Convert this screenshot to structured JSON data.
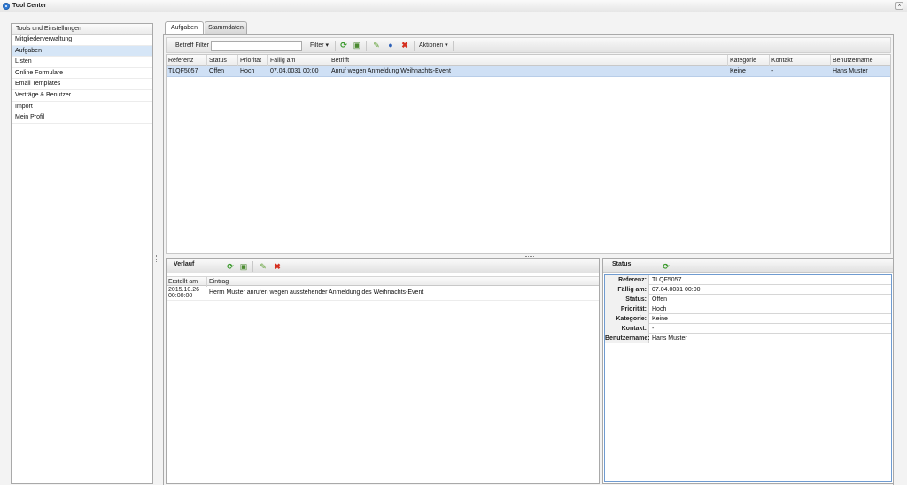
{
  "window": {
    "title": "Tool Center"
  },
  "sidebar": {
    "header": "Tools und Einstellungen",
    "items": [
      {
        "label": "Mitgliederverwaltung"
      },
      {
        "label": "Aufgaben"
      },
      {
        "label": "Listen"
      },
      {
        "label": "Online Formulare"
      },
      {
        "label": "Email Templates"
      },
      {
        "label": "Verträge & Benutzer"
      },
      {
        "label": "Import"
      },
      {
        "label": "Mein Profil"
      }
    ]
  },
  "tabs": [
    {
      "label": "Aufgaben"
    },
    {
      "label": "Stammdaten"
    }
  ],
  "toolbar": {
    "filter_label": "Betreff Filter :",
    "filter_value": "",
    "filter_button": "Filter ▾",
    "actions_button": "Aktionen ▾",
    "icons": [
      "refresh-icon",
      "new-icon",
      "edit-icon",
      "user-icon",
      "delete-icon"
    ]
  },
  "tasks": {
    "columns": [
      "Referenz",
      "Status",
      "Priorität",
      "Fällig am",
      "Betrifft",
      "Kategorie",
      "Kontakt",
      "Benutzername"
    ],
    "rows": [
      {
        "referenz": "TLQF5057",
        "status": "Offen",
        "prioritaet": "Hoch",
        "faellig": "07.04.0031 00:00",
        "betrifft": "Anruf wegen Anmeldung Weihnachts-Event",
        "kategorie": "Keine",
        "kontakt": "-",
        "benutzer": "Hans Muster"
      }
    ]
  },
  "verlauf": {
    "title": "Verlauf",
    "columns": [
      "Erstellt am",
      "Eintrag"
    ],
    "rows": [
      {
        "date_line1": "2015.10.26",
        "date_line2": "00:00:00",
        "entry": "Herrn Muster anrufen wegen ausstehender Anmeldung des Weihnachts-Event"
      }
    ]
  },
  "status_panel": {
    "title": "Status",
    "fields": [
      {
        "key": "Referenz:",
        "value": "TLQF5057"
      },
      {
        "key": "Fällig am:",
        "value": "07.04.0031 00:00"
      },
      {
        "key": "Status:",
        "value": "Offen"
      },
      {
        "key": "Priorität:",
        "value": "Hoch"
      },
      {
        "key": "Kategorie:",
        "value": "Keine"
      },
      {
        "key": "Kontakt:",
        "value": "-"
      },
      {
        "key": "Benutzername:",
        "value": "Hans Muster"
      }
    ]
  },
  "colors": {
    "selection": "#cfe0f5",
    "sidebar_selected": "#d6e6f7",
    "status_border": "#6f9bd0",
    "delete": "#d53020",
    "refresh": "#3b9a2c"
  }
}
